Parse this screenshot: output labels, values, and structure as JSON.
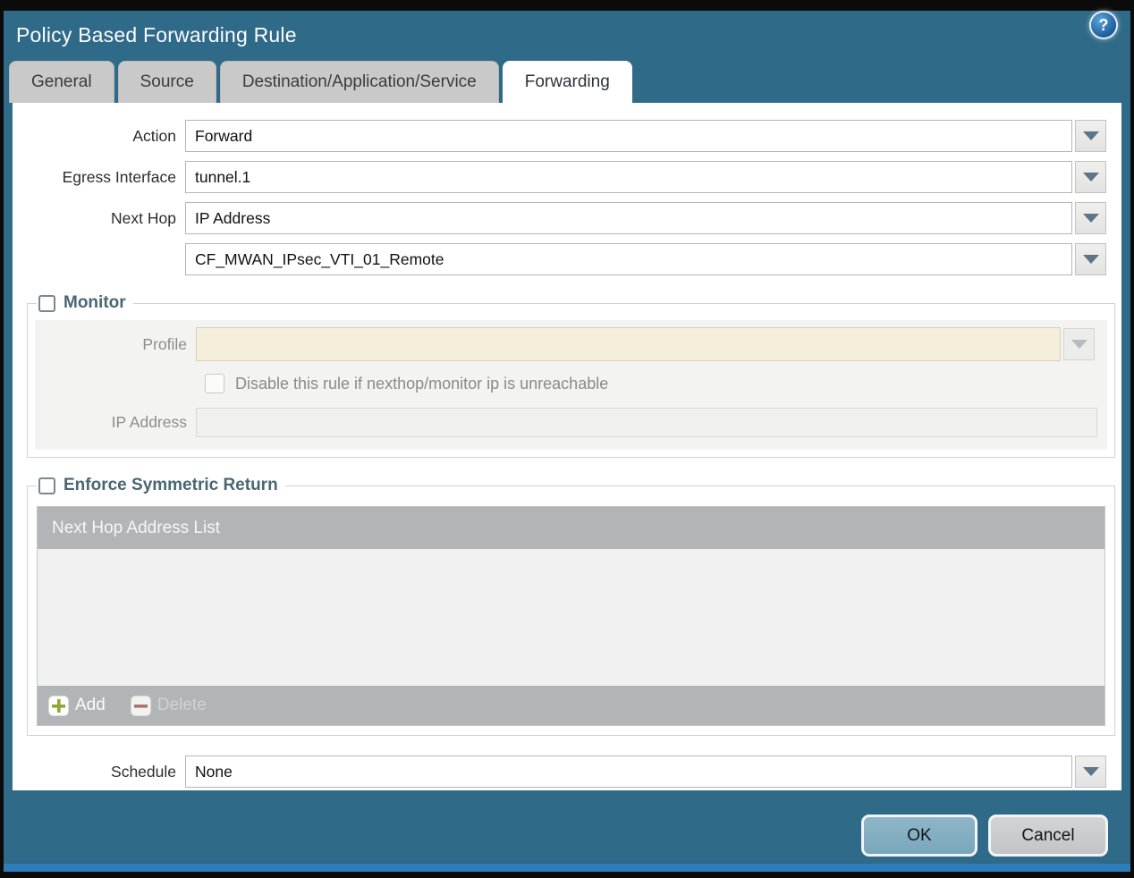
{
  "dialog": {
    "title": "Policy Based Forwarding Rule"
  },
  "tabs": {
    "items": [
      {
        "label": "General",
        "active": false
      },
      {
        "label": "Source",
        "active": false
      },
      {
        "label": "Destination/Application/Service",
        "active": false
      },
      {
        "label": "Forwarding",
        "active": true
      }
    ]
  },
  "form": {
    "action_label": "Action",
    "action_value": "Forward",
    "egress_label": "Egress Interface",
    "egress_value": "tunnel.1",
    "next_hop_label": "Next Hop",
    "next_hop_type_value": "IP Address",
    "next_hop_address_value": "CF_MWAN_IPsec_VTI_01_Remote",
    "schedule_label": "Schedule",
    "schedule_value": "None"
  },
  "monitor": {
    "legend": "Monitor",
    "checked": false,
    "profile_label": "Profile",
    "profile_value": "",
    "disable_checkbox_label": "Disable this rule if nexthop/monitor ip is unreachable",
    "disable_checked": false,
    "ip_address_label": "IP Address",
    "ip_address_value": ""
  },
  "symmetric_return": {
    "legend": "Enforce Symmetric Return",
    "checked": false,
    "table_header": "Next Hop Address List",
    "add_label": "Add",
    "delete_label": "Delete",
    "rows": []
  },
  "footer": {
    "ok_label": "OK",
    "cancel_label": "Cancel"
  },
  "help": {
    "glyph": "?"
  },
  "colors": {
    "titlebar_teal": "#2f6a89",
    "bottom_accent_blue": "#2e7dbb",
    "tab_inactive_gray": "#c9c9c9",
    "profile_field_cream": "#f5eeda",
    "table_bar_gray": "#b1b5b7",
    "table_body_gray": "#eff0ef",
    "ok_button_blue": "#84aec3",
    "cancel_button_gray": "#c9cbcd",
    "add_icon_green": "#8aa832",
    "delete_icon_red": "#a8766b"
  }
}
